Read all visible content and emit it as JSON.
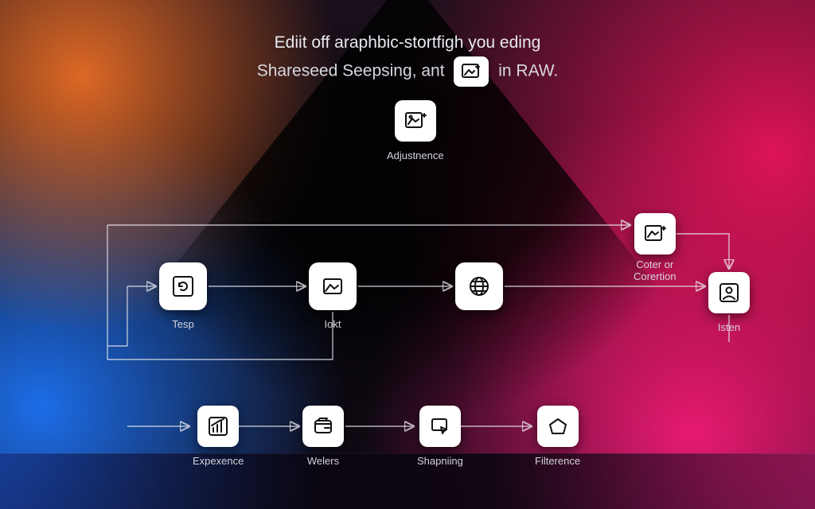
{
  "heading": {
    "line1": "Ediit off araphbic-stortfigh you eding",
    "line2a": "Shareseed Seepsing, ant",
    "line2b": "in RAW."
  },
  "nodes": {
    "adjust": {
      "label": "Adjustnence"
    },
    "tesp": {
      "label": "Tesp"
    },
    "iokt": {
      "label": "Iokt"
    },
    "globe": {
      "label": ""
    },
    "color": {
      "label": "Coter or\nCorertion"
    },
    "isten": {
      "label": "Isten"
    },
    "experience": {
      "label": "Expexence"
    },
    "welers": {
      "label": "Welers"
    },
    "shaping": {
      "label": "Shapniing"
    },
    "filter": {
      "label": "Filterence"
    }
  },
  "icons": {
    "inline": "image-export-icon",
    "adjust": "image-export-icon",
    "tesp": "refresh-icon",
    "iokt": "image-icon",
    "globe": "globe-icon",
    "color": "image-plus-icon",
    "isten": "person-icon",
    "experience": "bar-chart-icon",
    "welers": "wallet-icon",
    "shaping": "cursor-rect-icon",
    "filter": "pentagon-icon"
  },
  "colors": {
    "tile_bg": "#ffffff",
    "text": "#e9e9ef",
    "line": "rgba(235,235,240,0.75)"
  }
}
